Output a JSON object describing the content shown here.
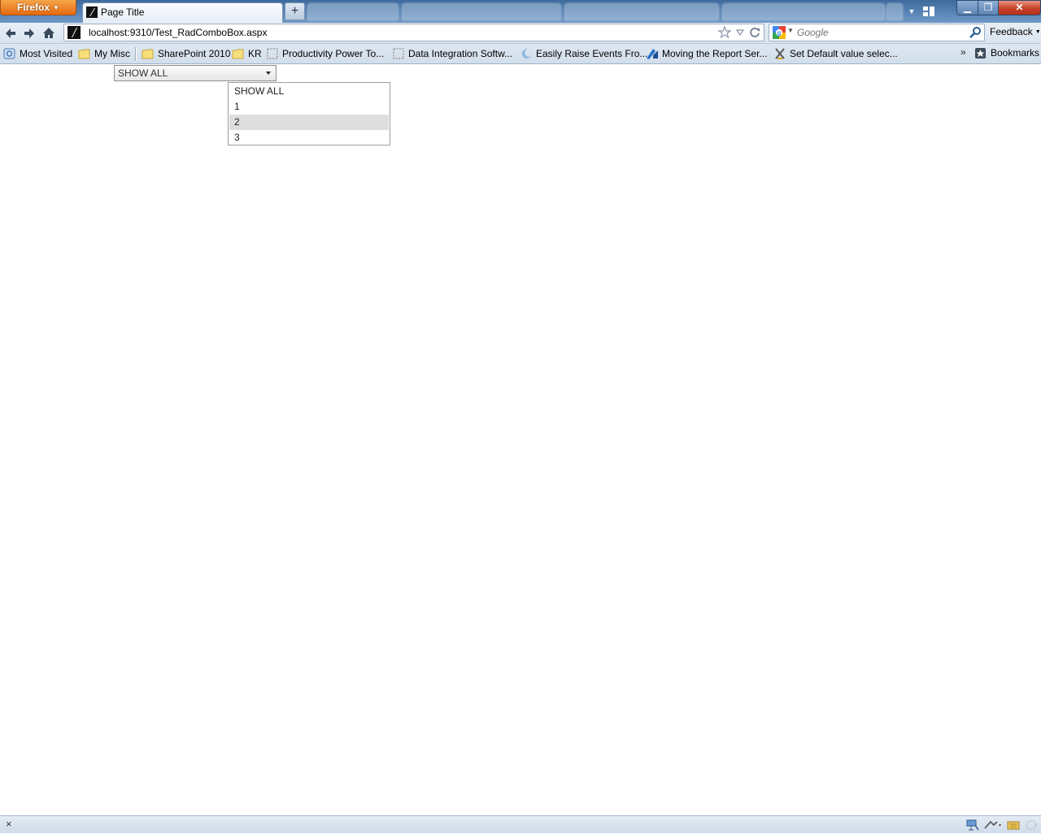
{
  "browser": {
    "app_button_label": "Firefox",
    "active_tab": {
      "title": "Page Title"
    },
    "new_tab_label": "+",
    "window_controls": {
      "minimize": "▁",
      "maximize": "❐",
      "close": "✕"
    }
  },
  "navigation": {
    "url": "localhost:9310/Test_RadComboBox.aspx",
    "search_placeholder": "Google",
    "feedback_label": "Feedback"
  },
  "bookmarks": {
    "items": [
      {
        "label": "Most Visited",
        "icon": "smart-folder-icon"
      },
      {
        "label": "My Misc",
        "icon": "folder-icon"
      },
      {
        "label": "SharePoint 2010",
        "icon": "folder-icon"
      },
      {
        "label": "KR",
        "icon": "folder-icon"
      },
      {
        "label": "Productivity Power To...",
        "icon": "page-icon"
      },
      {
        "label": "Data Integration Softw...",
        "icon": "page-icon"
      },
      {
        "label": "Easily Raise Events Fro...",
        "icon": "moon-icon"
      },
      {
        "label": "Moving the Report Ser...",
        "icon": "report-icon"
      },
      {
        "label": "Set Default value selec...",
        "icon": "xda-icon"
      }
    ],
    "overflow_label": "»",
    "bookmarks_menu_label": "Bookmarks"
  },
  "page": {
    "combo": {
      "value": "SHOW ALL",
      "options": [
        "SHOW ALL",
        "1",
        "2",
        "3"
      ],
      "highlighted_option": "2"
    }
  },
  "status": {
    "close_label": "×"
  },
  "colors": {
    "firefox_orange": "#e56a10",
    "titlebar_blue": "#5b86b8",
    "combo_highlight": "#dedede",
    "close_red": "#c5412a"
  }
}
